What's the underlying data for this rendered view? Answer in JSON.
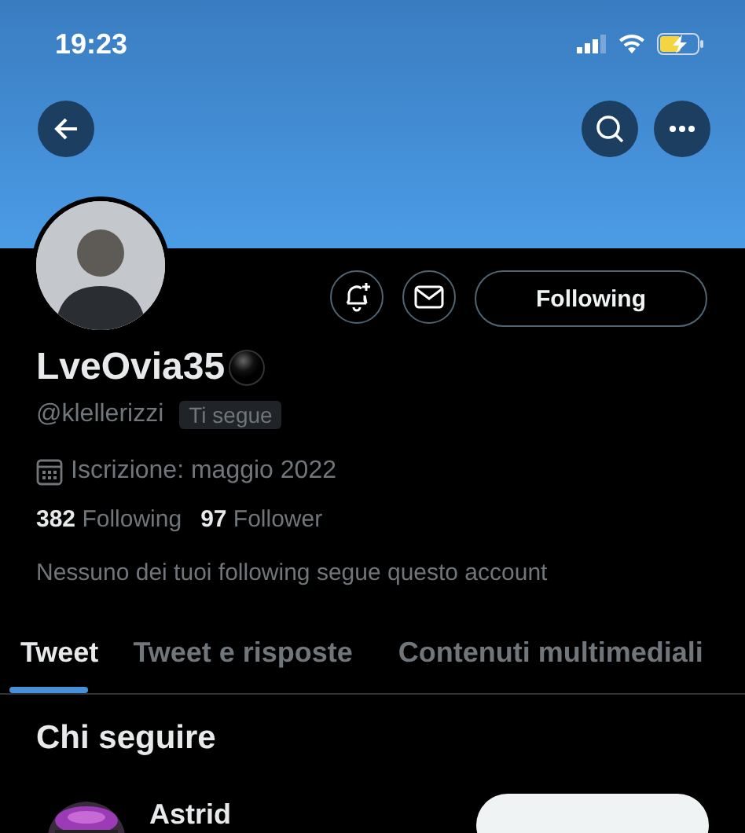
{
  "status_bar": {
    "time": "19:23"
  },
  "profile": {
    "name": "LveOvia35",
    "handle": "@klellerizzi",
    "follows_you": "Ti segue",
    "joined": "Iscrizione: maggio 2022",
    "following_count": "382",
    "following_label": "Following",
    "followers_count": "97",
    "followers_label": "Follower",
    "mutuals_note": "Nessuno dei tuoi following segue questo account",
    "follow_button": "Following"
  },
  "tabs": [
    {
      "label": "Tweet",
      "selected": true
    },
    {
      "label": "Tweet e risposte",
      "selected": false
    },
    {
      "label": "Contenuti multimediali",
      "selected": false
    }
  ],
  "who_to_follow": {
    "title": "Chi seguire",
    "accounts": [
      {
        "name": "Astrid"
      }
    ]
  }
}
